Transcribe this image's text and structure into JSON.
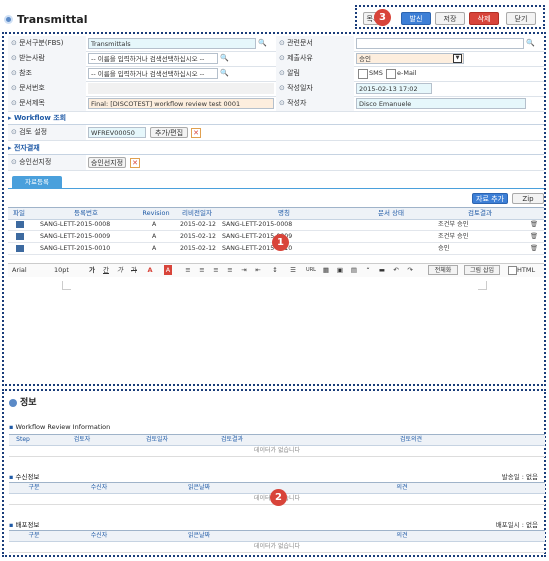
{
  "title": "Transmittal",
  "actions": {
    "list": "목록",
    "send": "발신",
    "save": "저장",
    "delete": "삭제",
    "close": "닫기"
  },
  "markers": {
    "one": "1",
    "two": "2",
    "three": "3"
  },
  "form": {
    "doc_type": {
      "label": "문서구분(FBS)",
      "value": "Transmittals"
    },
    "related_doc": {
      "label": "관련문서",
      "value": ""
    },
    "recipient": {
      "label": "받는사람",
      "placeholder": "-- 이름을 입력하거나 검색선택하십시오 --"
    },
    "submit_reason": {
      "label": "제출사유",
      "value": "승인"
    },
    "cc": {
      "label": "참조",
      "placeholder": "-- 이름을 입력하거나 검색선택하십시오 --"
    },
    "notify": {
      "label": "알림",
      "opt1": "SMS",
      "opt2": "e-Mail"
    },
    "doc_no": {
      "label": "문서번호",
      "value": ""
    },
    "created_date": {
      "label": "작성일자",
      "value": "2015-02-13 17:02"
    },
    "doc_title": {
      "label": "문서제목",
      "value": "Final: [DISCOTEST] workflow review test 0001"
    },
    "author": {
      "label": "작성자",
      "value": "Disco Emanuele"
    }
  },
  "workflow": {
    "section": "Workflow 조회",
    "review_label": "검토 설정",
    "review_value": "WFREV00050",
    "review_btn": "추가/편집",
    "approval_section": "전자결재",
    "approver_label": "승인선지정",
    "approver_btn": "승인선지정"
  },
  "attachments": {
    "tab": "자료등록",
    "add_btn": "자료 추가",
    "zip_btn": "Zip",
    "headers": [
      "파일",
      "등록번호",
      "Revision",
      "리비전일자",
      "명칭",
      "문서 상태",
      "검토결과"
    ],
    "rows": [
      {
        "no": "SANG-LETT-2015-0008",
        "rev": "A",
        "date": "2015-02-12",
        "name": "SANG-LETT-2015-0008",
        "status": "",
        "result": "조건부 승인"
      },
      {
        "no": "SANG-LETT-2015-0009",
        "rev": "A",
        "date": "2015-02-12",
        "name": "SANG-LETT-2015-0009",
        "status": "",
        "result": "조건부 승인"
      },
      {
        "no": "SANG-LETT-2015-0010",
        "rev": "A",
        "date": "2015-02-12",
        "name": "SANG-LETT-2015-0010",
        "status": "",
        "result": "승인"
      }
    ]
  },
  "editor": {
    "font": "Arial",
    "size": "10pt",
    "fullscreen": "전체화",
    "insert_image": "그림 삽입",
    "html": "HTML",
    "url": "URL"
  },
  "info": {
    "title": "정보",
    "review": {
      "title": "Workflow Review Information",
      "headers": [
        "Step",
        "검토자",
        "검토일자",
        "검토결과",
        "검토의견"
      ],
      "empty": "데이터가 없습니다"
    },
    "receive": {
      "title": "수신정보",
      "right": "발송일 : 없음",
      "headers": [
        "구분",
        "수신자",
        "읽은날짜",
        "의견"
      ],
      "empty": "데이터가 없습니다"
    },
    "distribute": {
      "title": "배포정보",
      "right": "배포일시 : 없음",
      "headers": [
        "구분",
        "수신자",
        "읽은날짜",
        "의견"
      ],
      "empty": "데이터가 없습니다"
    }
  }
}
